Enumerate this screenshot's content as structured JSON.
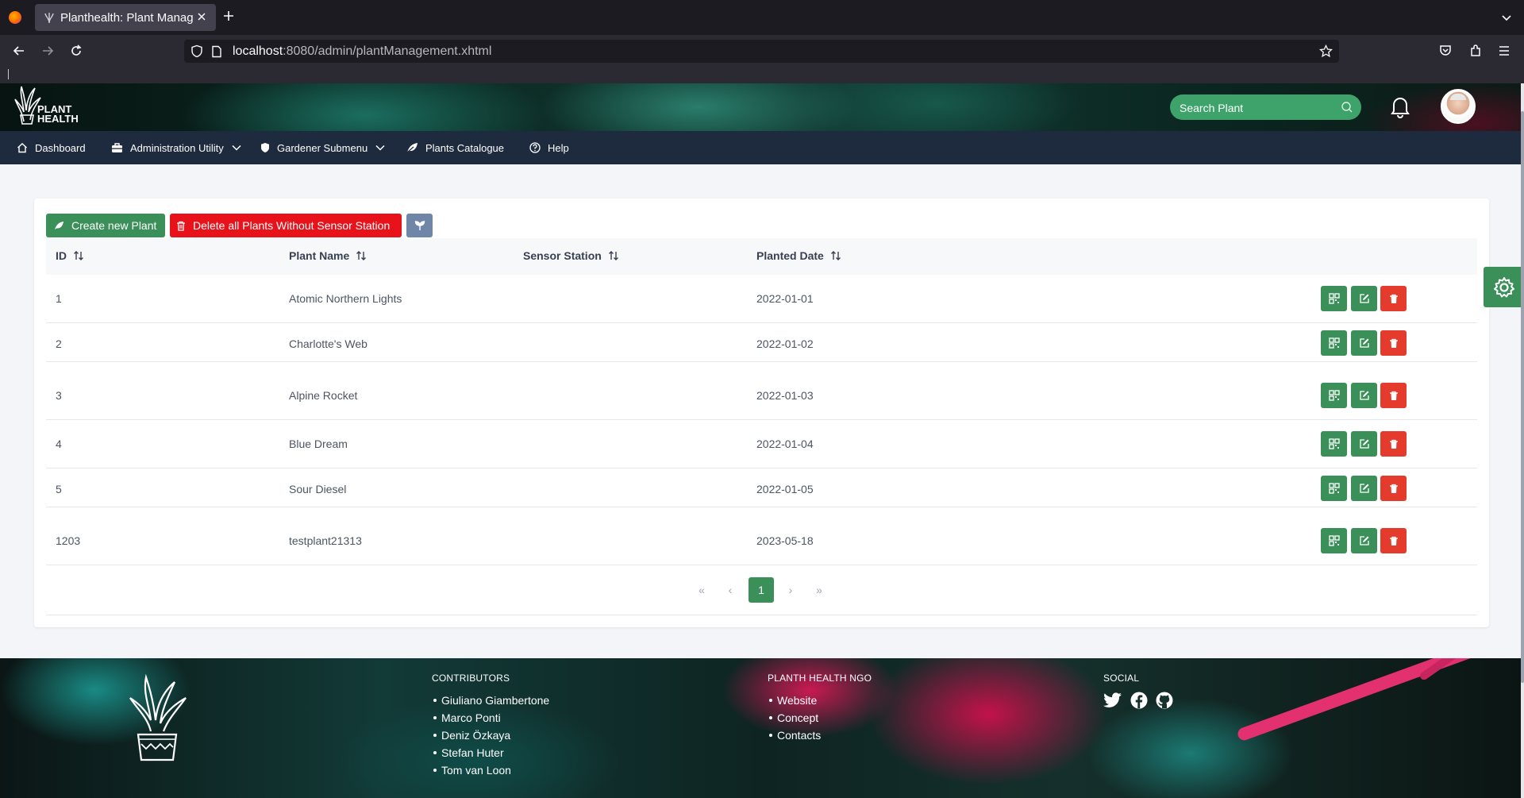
{
  "browser": {
    "tab_title": "Planthealth: Plant Management",
    "url_host": "localhost",
    "url_rest": ":8080/admin/plantManagement.xhtml"
  },
  "header": {
    "logo_line1": "PLANT",
    "logo_line2": "HEALTH",
    "search_placeholder": "Search Plant"
  },
  "menu": {
    "items": [
      {
        "label": "Dashboard",
        "icon": "home-icon"
      },
      {
        "label": "Administration Utility",
        "icon": "toolbox-icon",
        "has_dropdown": true
      },
      {
        "label": "Gardener Submenu",
        "icon": "shield-icon",
        "has_dropdown": true
      },
      {
        "label": "Plants Catalogue",
        "icon": "leaf-icon"
      },
      {
        "label": "Help",
        "icon": "question-icon"
      }
    ]
  },
  "toolbar": {
    "create_label": "Create new Plant",
    "delete_label": "Delete all Plants Without Sensor Station",
    "plant_icon": "sprout-icon"
  },
  "table": {
    "columns": [
      "ID",
      "Plant Name",
      "Sensor Station",
      "Planted Date"
    ],
    "rows": [
      {
        "id": "1",
        "name": "Atomic Northern Lights",
        "sensor": "",
        "date": "2022-01-01"
      },
      {
        "id": "2",
        "name": "Charlotte's Web",
        "sensor": "",
        "date": "2022-01-02"
      },
      {
        "id": "3",
        "name": "Alpine Rocket",
        "sensor": "",
        "date": "2022-01-03"
      },
      {
        "id": "4",
        "name": "Blue Dream",
        "sensor": "",
        "date": "2022-01-04"
      },
      {
        "id": "5",
        "name": "Sour Diesel",
        "sensor": "",
        "date": "2022-01-05"
      },
      {
        "id": "1203",
        "name": "testplant21313",
        "sensor": "",
        "date": "2023-05-18"
      }
    ],
    "row_actions": [
      "qr-code-icon",
      "edit-icon",
      "trash-icon"
    ]
  },
  "pagination": {
    "first": "«",
    "prev": "‹",
    "current": "1",
    "next": "›",
    "last": "»"
  },
  "footer": {
    "contributors_title": "CONTRIBUTORS",
    "contributors": [
      "Giuliano Giambertone",
      "Marco Ponti",
      "Deniz Özkaya",
      "Stefan Huter",
      "Tom van Loon"
    ],
    "ngo_title": "PLANTH HEALTH NGO",
    "ngo_links": [
      "Website",
      "Concept",
      "Contacts"
    ],
    "social_title": "SOCIAL",
    "social_icons": [
      "twitter-icon",
      "facebook-icon",
      "github-icon"
    ]
  },
  "colors": {
    "primary_green": "#3b8f59",
    "danger_red": "#e8121b",
    "menubar": "#1e2a3e",
    "secondary": "#6f86a8"
  }
}
